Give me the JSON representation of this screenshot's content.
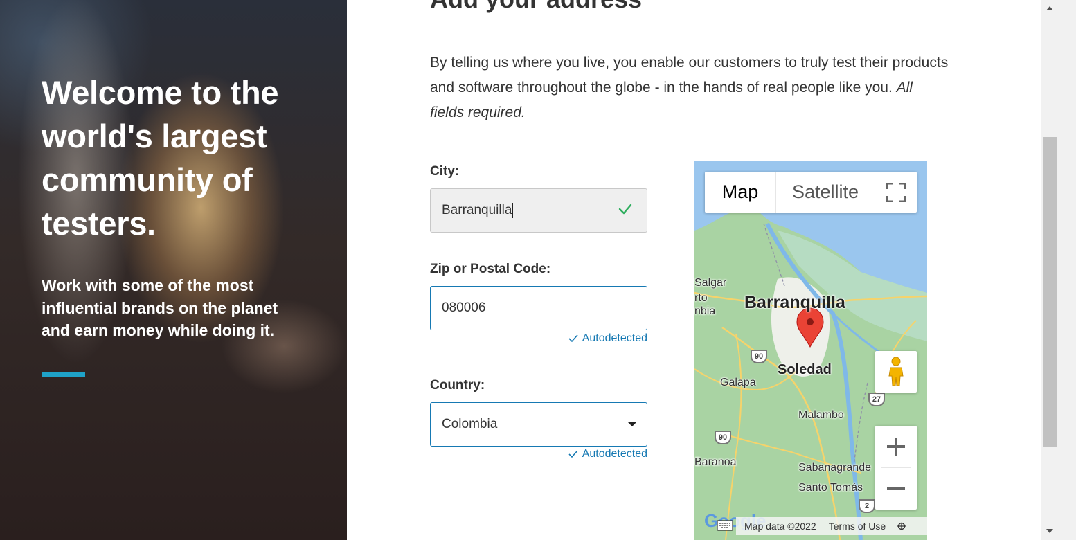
{
  "hero": {
    "title": "Welcome to the\nworld's largest\ncommunity of\ntesters.",
    "subtitle": "Work with some of the most\ninfluential brands on the planet\nand earn money while doing it.",
    "accent_color": "#1fa2c8"
  },
  "form": {
    "heading": "Add your address",
    "intro_text": "By telling us where you live, you enable our customers to truly test their products and software throughout the globe - in the hands of real people like you. ",
    "intro_required": "All fields required.",
    "city": {
      "label": "City:",
      "value": "Barranquilla",
      "status_icon": "check-icon"
    },
    "zip": {
      "label": "Zip or Postal Code:",
      "value": "080006",
      "note": "Autodetected"
    },
    "country": {
      "label": "Country:",
      "value": "Colombia",
      "note": "Autodetected"
    }
  },
  "map": {
    "tabs": {
      "map": "Map",
      "satellite": "Satellite"
    },
    "labels": {
      "city_main": "Barranquilla",
      "soledad": "Soledad",
      "salgar": "Salgar",
      "puerto": "rto",
      "colombia": "nbia",
      "galapa": "Galapa",
      "malambo": "Malambo",
      "baranoa": "Baranoa",
      "sabanagrande": "Sabanagrande",
      "santo_tomas": "Santo Tomás"
    },
    "shields": {
      "s1": "90",
      "s2": "27",
      "s3": "90",
      "s4": "2"
    },
    "footer": {
      "data": "Map data ©2022",
      "terms": "Terms of Use"
    },
    "logo_text": "Google",
    "colors": {
      "water": "#9ac6ee",
      "land": "#a9d3a3",
      "urban": "#eef0ea",
      "pin": "#ea4335"
    }
  }
}
